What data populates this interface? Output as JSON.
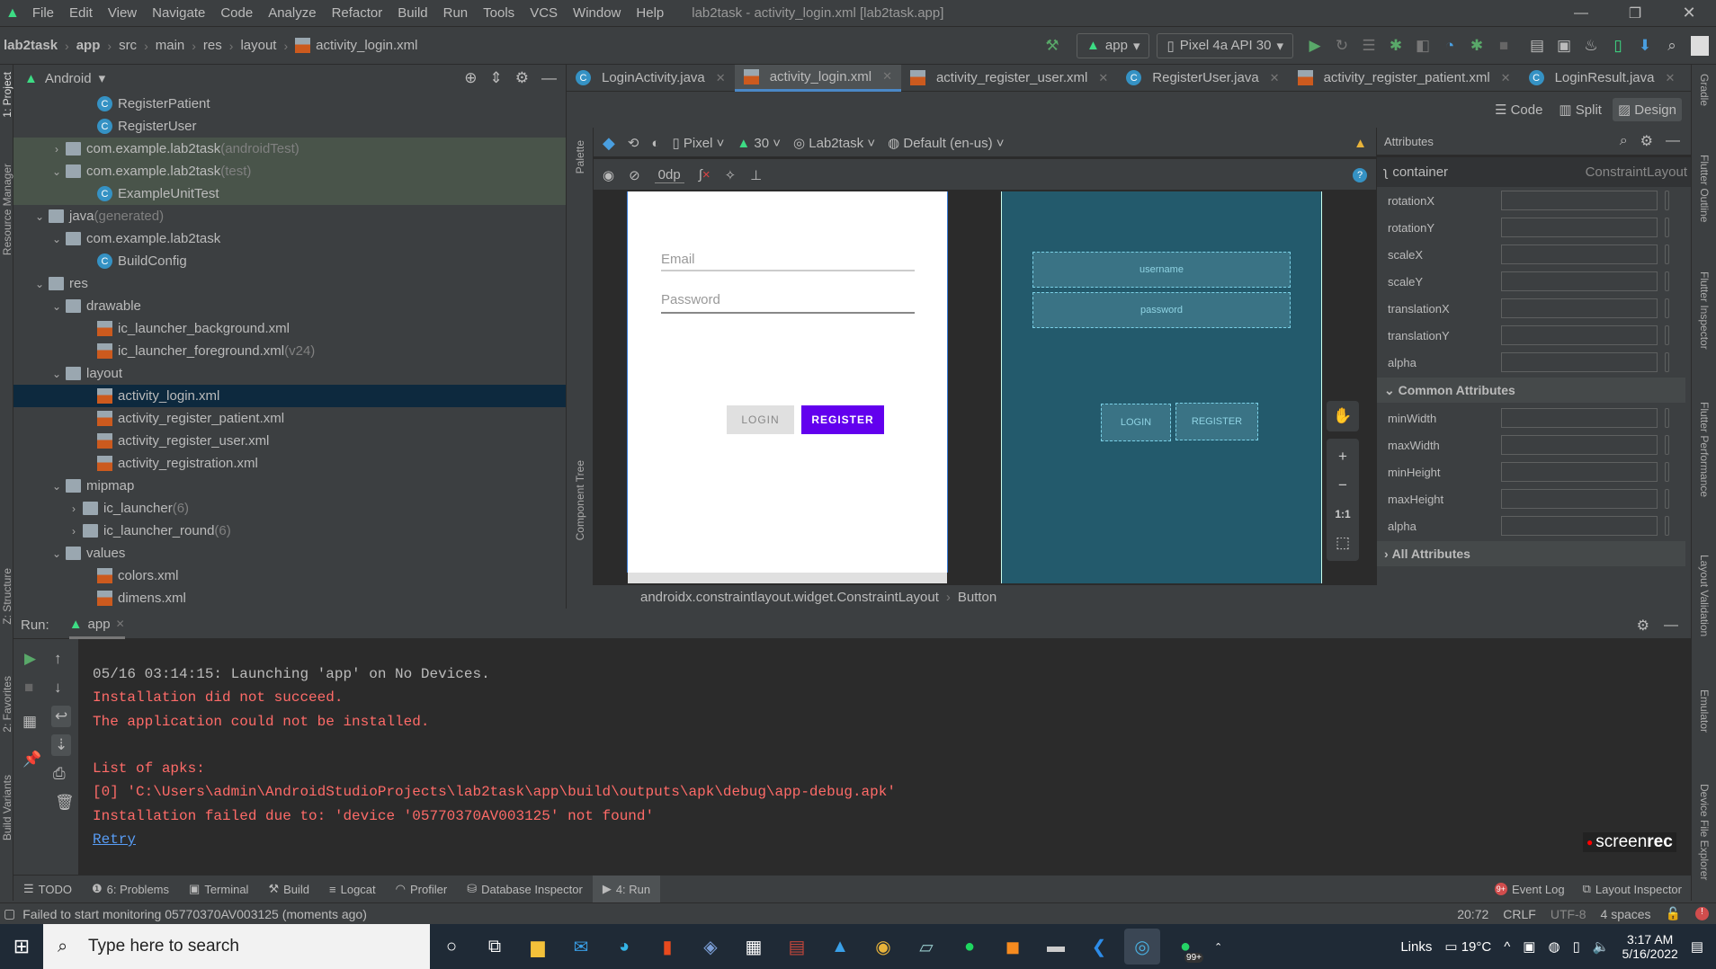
{
  "window": {
    "title": "lab2task - activity_login.xml [lab2task.app]",
    "menu": [
      "File",
      "Edit",
      "View",
      "Navigate",
      "Code",
      "Analyze",
      "Refactor",
      "Build",
      "Run",
      "Tools",
      "VCS",
      "Window",
      "Help"
    ]
  },
  "breadcrumb": [
    "lab2task",
    "app",
    "src",
    "main",
    "res",
    "layout",
    "activity_login.xml"
  ],
  "toolbar": {
    "run_config": "app",
    "device": "Pixel 4a API 30"
  },
  "project": {
    "view": "Android",
    "items": [
      {
        "label": "RegisterPatient",
        "suffix": "",
        "type": "class",
        "indent": 4,
        "arrow": "",
        "style": ""
      },
      {
        "label": "RegisterUser",
        "suffix": "",
        "type": "class",
        "indent": 4,
        "arrow": "",
        "style": ""
      },
      {
        "label": "com.example.lab2task",
        "suffix": " (androidTest)",
        "type": "folder",
        "indent": 2,
        "arrow": "›",
        "style": "green"
      },
      {
        "label": "com.example.lab2task",
        "suffix": " (test)",
        "type": "folder",
        "indent": 2,
        "arrow": "⌄",
        "style": "green"
      },
      {
        "label": "ExampleUnitTest",
        "suffix": "",
        "type": "class",
        "indent": 4,
        "arrow": "",
        "style": "green"
      },
      {
        "label": "java",
        "suffix": " (generated)",
        "type": "folder",
        "indent": 1,
        "arrow": "⌄",
        "style": ""
      },
      {
        "label": "com.example.lab2task",
        "suffix": "",
        "type": "folder",
        "indent": 2,
        "arrow": "⌄",
        "style": ""
      },
      {
        "label": "BuildConfig",
        "suffix": "",
        "type": "class",
        "indent": 4,
        "arrow": "",
        "style": ""
      },
      {
        "label": "res",
        "suffix": "",
        "type": "folder",
        "indent": 1,
        "arrow": "⌄",
        "style": ""
      },
      {
        "label": "drawable",
        "suffix": "",
        "type": "folder",
        "indent": 2,
        "arrow": "⌄",
        "style": ""
      },
      {
        "label": "ic_launcher_background.xml",
        "suffix": "",
        "type": "xml",
        "indent": 4,
        "arrow": "",
        "style": ""
      },
      {
        "label": "ic_launcher_foreground.xml",
        "suffix": " (v24)",
        "type": "xml",
        "indent": 4,
        "arrow": "",
        "style": ""
      },
      {
        "label": "layout",
        "suffix": "",
        "type": "folder",
        "indent": 2,
        "arrow": "⌄",
        "style": ""
      },
      {
        "label": "activity_login.xml",
        "suffix": "",
        "type": "xml",
        "indent": 4,
        "arrow": "",
        "style": "sel"
      },
      {
        "label": "activity_register_patient.xml",
        "suffix": "",
        "type": "xml",
        "indent": 4,
        "arrow": "",
        "style": ""
      },
      {
        "label": "activity_register_user.xml",
        "suffix": "",
        "type": "xml",
        "indent": 4,
        "arrow": "",
        "style": ""
      },
      {
        "label": "activity_registration.xml",
        "suffix": "",
        "type": "xml",
        "indent": 4,
        "arrow": "",
        "style": ""
      },
      {
        "label": "mipmap",
        "suffix": "",
        "type": "folder",
        "indent": 2,
        "arrow": "⌄",
        "style": ""
      },
      {
        "label": "ic_launcher",
        "suffix": " (6)",
        "type": "folder",
        "indent": 3,
        "arrow": "›",
        "style": ""
      },
      {
        "label": "ic_launcher_round",
        "suffix": " (6)",
        "type": "folder",
        "indent": 3,
        "arrow": "›",
        "style": ""
      },
      {
        "label": "values",
        "suffix": "",
        "type": "folder",
        "indent": 2,
        "arrow": "⌄",
        "style": ""
      },
      {
        "label": "colors.xml",
        "suffix": "",
        "type": "xml",
        "indent": 4,
        "arrow": "",
        "style": ""
      },
      {
        "label": "dimens.xml",
        "suffix": "",
        "type": "xml",
        "indent": 4,
        "arrow": "",
        "style": ""
      }
    ]
  },
  "tabs": [
    {
      "label": "LoginActivity.java",
      "type": "class",
      "active": false
    },
    {
      "label": "activity_login.xml",
      "type": "xml",
      "active": true
    },
    {
      "label": "activity_register_user.xml",
      "type": "xml",
      "active": false
    },
    {
      "label": "RegisterUser.java",
      "type": "class",
      "active": false
    },
    {
      "label": "activity_register_patient.xml",
      "type": "xml",
      "active": false
    },
    {
      "label": "LoginResult.java",
      "type": "class",
      "active": false
    },
    {
      "label": "s",
      "type": "xml",
      "active": false
    }
  ],
  "modes": {
    "code": "Code",
    "split": "Split",
    "design": "Design",
    "active": "Design"
  },
  "design_toolbar": {
    "device": "Pixel",
    "api": "30",
    "theme": "Lab2task",
    "locale": "Default (en-us)",
    "margin": "0dp"
  },
  "side_labels": {
    "palette": "Palette",
    "component_tree": "Component Tree",
    "project": "1: Project",
    "resource_manager": "Resource Manager",
    "structure": "Z: Structure",
    "favorites": "2: Favorites",
    "build_variants": "Build Variants",
    "gradle": "Gradle",
    "flutter_outline": "Flutter Outline",
    "flutter_inspector": "Flutter Inspector",
    "flutter_performance": "Flutter Performance",
    "layout_validation": "Layout Validation",
    "emulator": "Emulator",
    "device_file_explorer": "Device File Explorer"
  },
  "preview": {
    "email_hint": "Email",
    "password_hint": "Password",
    "login": "LOGIN",
    "register": "REGISTER",
    "accent": "#6200ee"
  },
  "blueprint": {
    "username": "username",
    "password": "password",
    "login": "LOGIN",
    "register": "REGISTER"
  },
  "zoom_controls": {
    "reset": "1:1"
  },
  "attributes": {
    "title": "Attributes",
    "component": "container",
    "component_type": "ConstraintLayout",
    "transforms": [
      "rotationX",
      "rotationY",
      "scaleX",
      "scaleY",
      "translationX",
      "translationY",
      "alpha"
    ],
    "common_title": "Common Attributes",
    "common": [
      "minWidth",
      "maxWidth",
      "minHeight",
      "maxHeight",
      "alpha"
    ],
    "all_title": "All Attributes"
  },
  "component_path": [
    "androidx.constraintlayout.widget.ConstraintLayout",
    "Button"
  ],
  "run": {
    "label": "Run:",
    "tab": "app",
    "lines": [
      {
        "text": "05/16 03:14:15: Launching 'app' on No Devices.",
        "kind": "info"
      },
      {
        "text": "Installation did not succeed.",
        "kind": "err"
      },
      {
        "text": "The application could not be installed.",
        "kind": "err"
      },
      {
        "text": "",
        "kind": "err"
      },
      {
        "text": "List of apks:",
        "kind": "err"
      },
      {
        "text": "[0] 'C:\\Users\\admin\\AndroidStudioProjects\\lab2task\\app\\build\\outputs\\apk\\debug\\app-debug.apk'",
        "kind": "err"
      },
      {
        "text": "Installation failed due to: 'device '05770370AV003125' not found'",
        "kind": "err"
      },
      {
        "text": "Retry",
        "kind": "link"
      }
    ]
  },
  "watermark": {
    "a": "screen",
    "b": "rec"
  },
  "bottom_tabs": [
    "TODO",
    "6: Problems",
    "Terminal",
    "Build",
    "Logcat",
    "Profiler",
    "Database Inspector",
    "4: Run"
  ],
  "bottom_right": {
    "event_log": "Event Log",
    "event_badge": "9+",
    "layout_inspector": "Layout Inspector"
  },
  "status": {
    "message": "Failed to start monitoring 05770370AV003125 (moments ago)",
    "position": "20:72",
    "line_sep": "CRLF",
    "encoding": "UTF-8",
    "indent": "4 spaces"
  },
  "taskbar": {
    "search_placeholder": "Type here to search",
    "links": "Links",
    "weather": "19°C",
    "time": "3:17 AM",
    "date": "5/16/2022",
    "whatsapp_badge": "99+"
  }
}
